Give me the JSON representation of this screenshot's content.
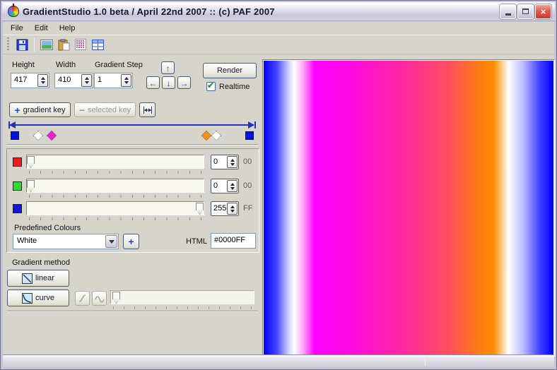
{
  "window": {
    "title": "GradientStudio 1.0 beta / April 22nd 2007 :: (c) PAF 2007"
  },
  "menu": {
    "items": [
      "File",
      "Edit",
      "Help"
    ]
  },
  "toolbar": {
    "icons": [
      "save-icon",
      "image-icon",
      "paste-icon",
      "pink-grid-icon",
      "blue-grid-icon"
    ]
  },
  "controls": {
    "height": {
      "label": "Height",
      "value": "417"
    },
    "width": {
      "label": "Width",
      "value": "410"
    },
    "gradient_step": {
      "label": "Gradient Step",
      "value": "1"
    },
    "render_label": "Render",
    "realtime_label": "Realtime",
    "realtime_checked": true,
    "add_key_label": "gradient key",
    "remove_key_label": "selected key"
  },
  "key_track": {
    "markers": [
      {
        "shape": "square",
        "color": "#0010DD",
        "pos": 2.5
      },
      {
        "shape": "diamond",
        "color": "#FFFFFF",
        "pos": 12
      },
      {
        "shape": "diamond",
        "color": "#EE22CC",
        "pos": 17.5
      },
      {
        "shape": "diamond",
        "color": "#F59018",
        "pos": 80
      },
      {
        "shape": "diamond",
        "color": "#FFFFFF",
        "pos": 84
      },
      {
        "shape": "square",
        "color": "#0010DD",
        "pos": 97.5
      }
    ]
  },
  "sliders": {
    "rows": [
      {
        "channel": "red",
        "swatch": "#EE1C1C",
        "value": "0",
        "hex": "00",
        "pos": 0
      },
      {
        "channel": "green",
        "swatch": "#2ADD2A",
        "value": "0",
        "hex": "00",
        "pos": 0
      },
      {
        "channel": "blue",
        "swatch": "#1414E0",
        "value": "255",
        "hex": "FF",
        "pos": 100
      }
    ]
  },
  "colours": {
    "label": "Predefined Colours",
    "selected": "White",
    "html_label": "HTML",
    "html_value": "#0000FF"
  },
  "gradient_method": {
    "label": "Gradient method",
    "linear_label": "linear",
    "curve_label": "curve"
  },
  "preview": {
    "stops": [
      {
        "color": "#0000FF",
        "pos": 0
      },
      {
        "color": "#4444FF",
        "pos": 4.5
      },
      {
        "color": "#CCCCFF",
        "pos": 8.5
      },
      {
        "color": "#FFFFFF",
        "pos": 10.5
      },
      {
        "color": "#FFAAF8",
        "pos": 13.5
      },
      {
        "color": "#FF00FF",
        "pos": 17.5
      },
      {
        "color": "#FF0AE0",
        "pos": 30
      },
      {
        "color": "#FF28A0",
        "pos": 48
      },
      {
        "color": "#FF5060",
        "pos": 64
      },
      {
        "color": "#FF7A14",
        "pos": 74
      },
      {
        "color": "#FF8C00",
        "pos": 79.5
      },
      {
        "color": "#FFFFFF",
        "pos": 84.5
      },
      {
        "color": "#BBBBFF",
        "pos": 89.5
      },
      {
        "color": "#3A3AFF",
        "pos": 95.5
      },
      {
        "color": "#0000FF",
        "pos": 100
      }
    ]
  },
  "statusbar": {
    "left": "",
    "right": ""
  }
}
